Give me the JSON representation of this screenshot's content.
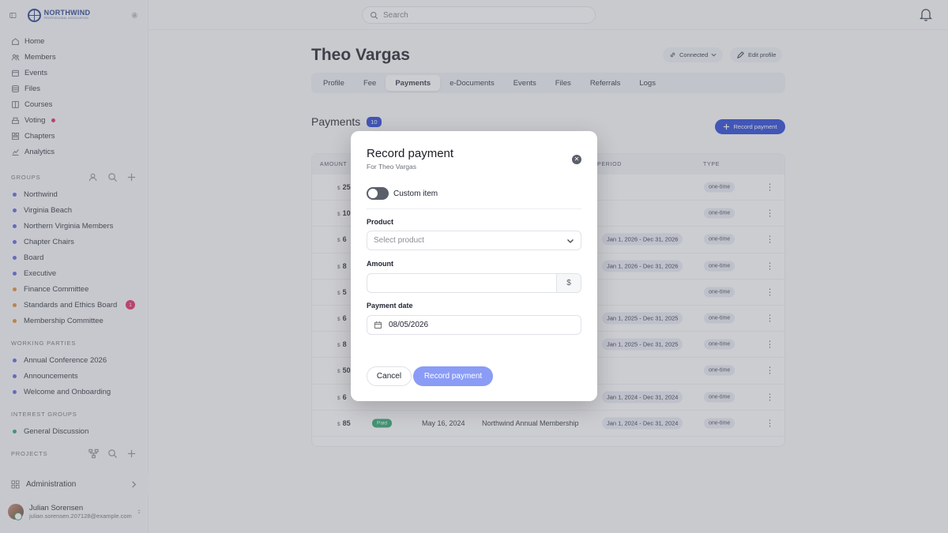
{
  "brand": {
    "name": "NORTHWIND",
    "tagline": "PROFESSIONAL ASSOCIATION"
  },
  "nav": [
    {
      "label": "Home",
      "icon": "home-icon"
    },
    {
      "label": "Members",
      "icon": "members-icon"
    },
    {
      "label": "Events",
      "icon": "calendar-icon"
    },
    {
      "label": "Files",
      "icon": "files-icon"
    },
    {
      "label": "Courses",
      "icon": "book-icon"
    },
    {
      "label": "Voting",
      "icon": "ballot-icon"
    },
    {
      "label": "Chapters",
      "icon": "chapters-icon"
    },
    {
      "label": "Analytics",
      "icon": "analytics-icon"
    }
  ],
  "groups": {
    "header": "GROUPS",
    "items": [
      {
        "label": "Northwind",
        "color": "#5b5fe0"
      },
      {
        "label": "Virginia Beach",
        "color": "#5b5fe0"
      },
      {
        "label": "Northern Virginia Members",
        "color": "#5b5fe0"
      },
      {
        "label": "Chapter Chairs",
        "color": "#5b5fe0"
      },
      {
        "label": "Board",
        "color": "#5b5fe0"
      },
      {
        "label": "Executive",
        "color": "#5b5fe0"
      },
      {
        "label": "Finance Committee",
        "color": "#e08a2b"
      },
      {
        "label": "Standards and Ethics Board",
        "color": "#e08a2b",
        "badge": "1"
      },
      {
        "label": "Membership Committee",
        "color": "#e08a2b"
      }
    ]
  },
  "working": {
    "header": "WORKING PARTIES",
    "items": [
      {
        "label": "Annual Conference 2026",
        "color": "#5b5fe0"
      },
      {
        "label": "Announcements",
        "color": "#5b5fe0"
      },
      {
        "label": "Welcome and Onboarding",
        "color": "#5b5fe0"
      }
    ]
  },
  "interest": {
    "header": "INTEREST GROUPS",
    "items": [
      {
        "label": "General Discussion",
        "color": "#25a46b"
      }
    ]
  },
  "projects": {
    "header": "PROJECTS"
  },
  "admin": {
    "label": "Administration"
  },
  "user": {
    "name": "Julian Sorensen",
    "email": "julian.sorensen.207128@example.com"
  },
  "search": {
    "placeholder": "Search"
  },
  "profile": {
    "name": "Theo Vargas",
    "connected": "Connected",
    "edit": "Edit profile"
  },
  "tabs": [
    "Profile",
    "Fee",
    "Payments",
    "e-Documents",
    "Events",
    "Files",
    "Referrals",
    "Logs"
  ],
  "active_tab": "Payments",
  "payments": {
    "title": "Payments",
    "count": "10",
    "record_button": "Record payment",
    "columns": {
      "amount": "AMOUNT",
      "period": "PERIOD",
      "type": "TYPE"
    },
    "rows": [
      {
        "currency": "$",
        "amount": "25",
        "period": "",
        "type": "one-time"
      },
      {
        "currency": "$",
        "amount": "10",
        "period": "",
        "type": "one-time"
      },
      {
        "currency": "$",
        "amount": "6",
        "period": "Jan 1, 2026 - Dec 31, 2026",
        "type": "one-time"
      },
      {
        "currency": "$",
        "amount": "8",
        "period": "Jan 1, 2026 - Dec 31, 2026",
        "type": "one-time"
      },
      {
        "currency": "$",
        "amount": "5",
        "period": "",
        "type": "one-time"
      },
      {
        "currency": "$",
        "amount": "6",
        "period": "Jan 1, 2025 - Dec 31, 2025",
        "type": "one-time"
      },
      {
        "currency": "$",
        "amount": "8",
        "period": "Jan 1, 2025 - Dec 31, 2025",
        "type": "one-time"
      },
      {
        "currency": "$",
        "amount": "50",
        "period": "",
        "type": "one-time"
      },
      {
        "currency": "$",
        "amount": "6",
        "period": "Jan 1, 2024 - Dec 31, 2024",
        "type": "one-time"
      },
      {
        "currency": "$",
        "amount": "85",
        "status": "Paid",
        "date": "May 16, 2024",
        "description": "Northwind Annual Membership",
        "period": "Jan 1, 2024 - Dec 31, 2024",
        "type": "one-time"
      }
    ]
  },
  "modal": {
    "title": "Record payment",
    "subtitle": "For Theo Vargas",
    "custom_item": "Custom item",
    "product_label": "Product",
    "product_placeholder": "Select product",
    "amount_label": "Amount",
    "amount_value": "",
    "currency": "$",
    "date_label": "Payment date",
    "date_value": "08/05/2026",
    "cancel": "Cancel",
    "submit": "Record payment"
  }
}
